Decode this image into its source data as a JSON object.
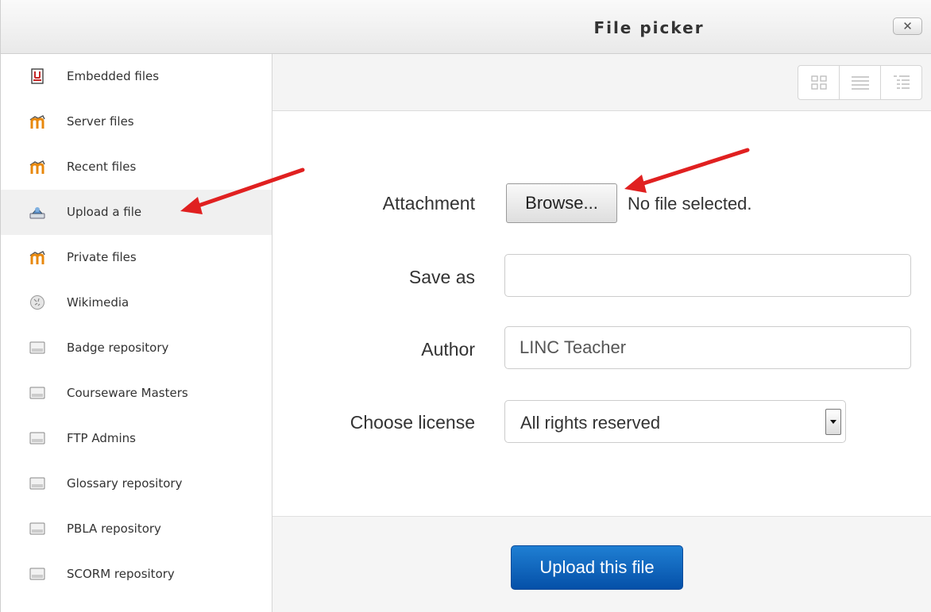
{
  "dialog": {
    "title": "File picker",
    "close_label": "✕"
  },
  "sidebar": {
    "items": [
      {
        "label": "Embedded files",
        "icon": "embedded-files-icon"
      },
      {
        "label": "Server files",
        "icon": "moodle-icon"
      },
      {
        "label": "Recent files",
        "icon": "moodle-icon"
      },
      {
        "label": "Upload a file",
        "icon": "upload-icon",
        "active": true
      },
      {
        "label": "Private files",
        "icon": "moodle-icon"
      },
      {
        "label": "Wikimedia",
        "icon": "wikimedia-icon"
      },
      {
        "label": "Badge repository",
        "icon": "repository-icon"
      },
      {
        "label": "Courseware Masters",
        "icon": "repository-icon"
      },
      {
        "label": "FTP Admins",
        "icon": "repository-icon"
      },
      {
        "label": "Glossary repository",
        "icon": "repository-icon"
      },
      {
        "label": "PBLA repository",
        "icon": "repository-icon"
      },
      {
        "label": "SCORM repository",
        "icon": "repository-icon"
      }
    ]
  },
  "toolbar": {
    "views": [
      "icons-view",
      "list-view",
      "tree-view"
    ]
  },
  "form": {
    "attachment_label": "Attachment",
    "browse_label": "Browse...",
    "no_file_text": "No file selected.",
    "save_as_label": "Save as",
    "save_as_value": "",
    "author_label": "Author",
    "author_value": "LINC Teacher",
    "license_label": "Choose license",
    "license_value": "All rights reserved"
  },
  "footer": {
    "upload_label": "Upload this file"
  },
  "colors": {
    "accent": "#0a5fbf",
    "annotation_arrow": "#e02020"
  }
}
